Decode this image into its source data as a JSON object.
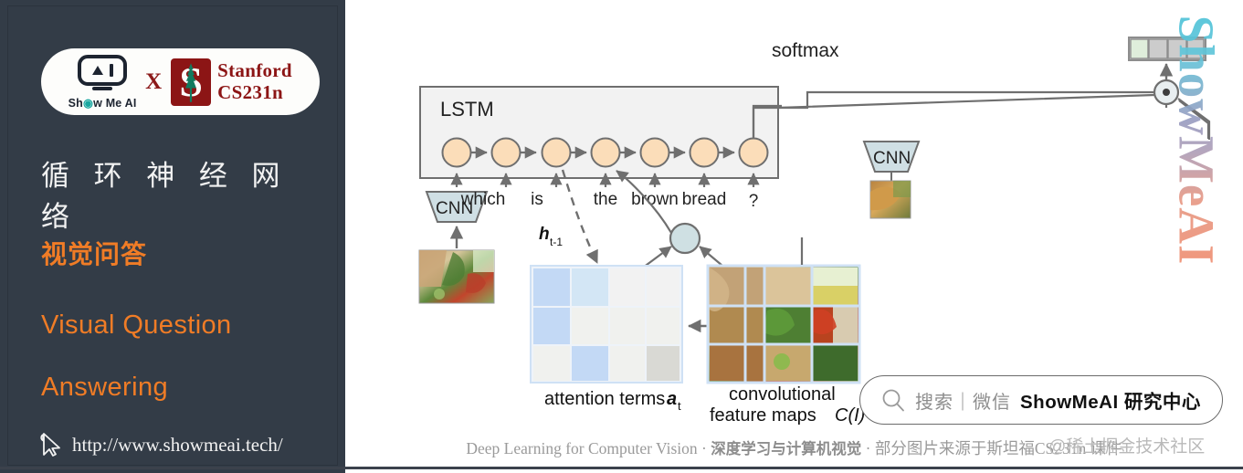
{
  "sidebar": {
    "logo": {
      "showmeai_label": "Show Me AI",
      "cross": "X",
      "stanford_line1": "Stanford",
      "stanford_line2": "CS231n",
      "stanford_monogram": "S",
      "tree_icon": "stanford-tree-icon"
    },
    "title_cn": "循 环 神 经 网 络",
    "subtitle_cn": "视觉问答",
    "title_en_line1": "Visual Question",
    "title_en_line2": "Answering",
    "site_url": "http://www.showmeai.tech/",
    "cursor_icon": "cursor-pointer-icon",
    "bg_color": "#333c47",
    "accent_color": "#f07c26"
  },
  "diagram": {
    "softmax_label": "softmax",
    "softmax_cells": [
      "#dfeedb",
      "#cccccc",
      "#cccccc",
      "#cccccc"
    ],
    "lstm_label": "LSTM",
    "lstm_cell_count": 7,
    "cnn_left_label": "CNN",
    "cnn_right_label": "CNN",
    "word_tokens": [
      "which",
      "is",
      "the",
      "brown",
      "bread",
      "?"
    ],
    "hidden_state_label": "h",
    "hidden_state_sub": "t-1",
    "attention_caption_main": "attention terms",
    "attention_caption_sym": "a",
    "attention_caption_sub": "t",
    "featuremaps_caption_line1": "convolutional",
    "featuremaps_caption_line2": "feature maps",
    "featuremaps_caption_sym": "C(I)",
    "attention_grid": {
      "rows": 3,
      "cols": 4,
      "values": [
        [
          0.55,
          0.42,
          0.04,
          0.04
        ],
        [
          0.58,
          0.05,
          0.04,
          0.04
        ],
        [
          0.05,
          0.6,
          0.04,
          0.16
        ]
      ]
    },
    "node_colors": {
      "lstm_cell": "#fbddb9",
      "cnn_trapezoid": "#cfdfe4",
      "attention_node": "#cfe0e3",
      "box_fill": "#f2f2f2",
      "stroke": "#6f6f6f",
      "attention_blue": "#c3d9f5"
    }
  },
  "footer": {
    "text_en": "Deep Learning for Computer Vision",
    "sep": " · ",
    "text_cn_1": "深度学习与计算机视觉",
    "text_cn_2": "部分图片来源于斯坦福CS231n 课件",
    "watermark": "@稀土掘金技术社区"
  },
  "search_widget": {
    "icon": "search-icon",
    "placeholder": "搜索｜微信",
    "brand": "ShowMeAI 研究中心"
  },
  "brand_vertical": {
    "text": "ShowMeAI",
    "gradient_from": "#4fc3d9",
    "gradient_to": "#ef8f72"
  }
}
